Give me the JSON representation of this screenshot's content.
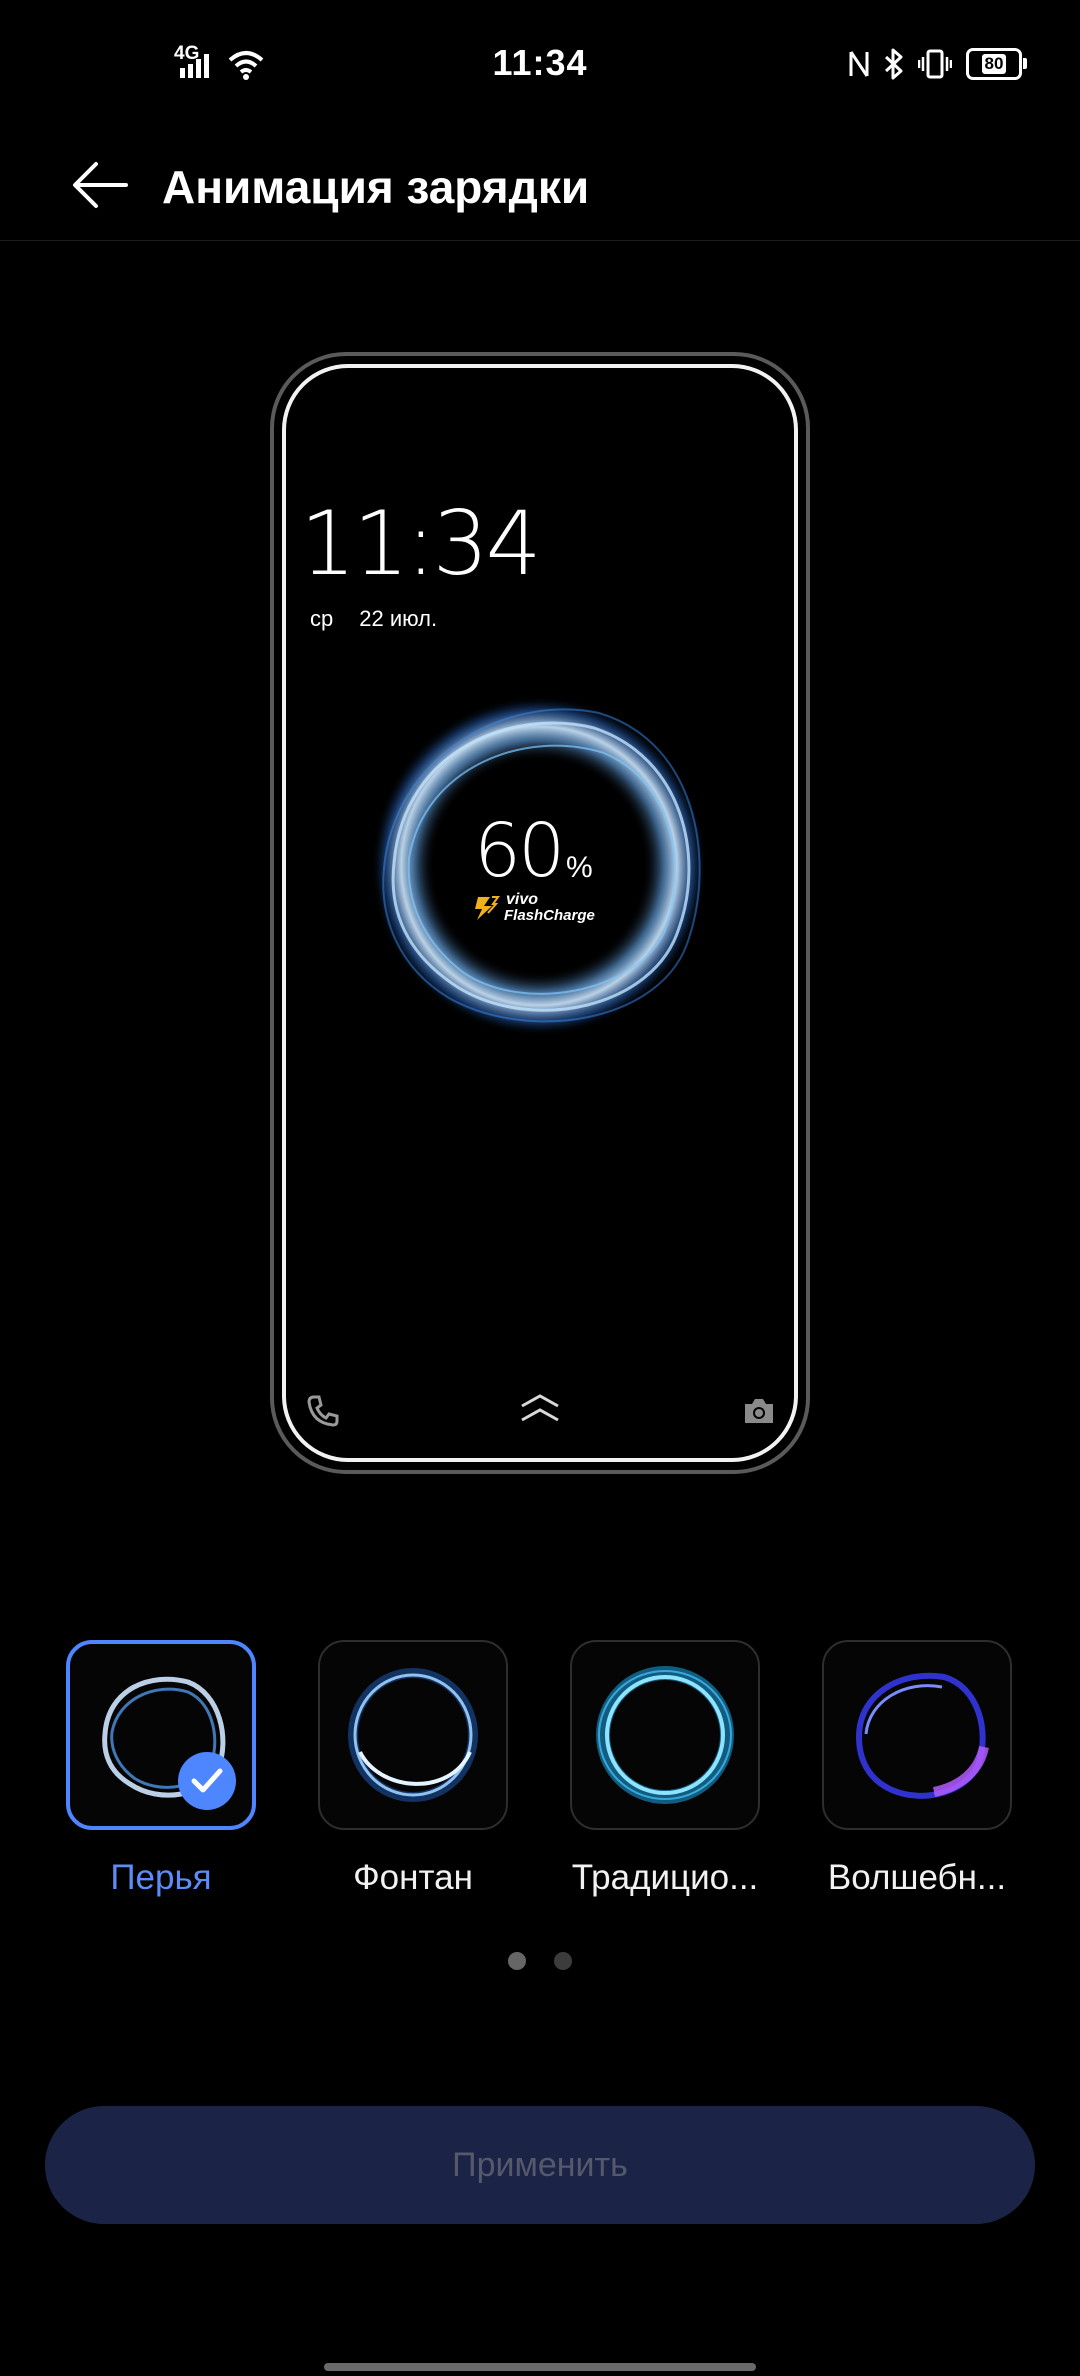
{
  "status_bar": {
    "time": "11:34",
    "network": "4G",
    "battery": "80",
    "icons": [
      "signal-icon",
      "wifi-icon",
      "nfc-icon",
      "bluetooth-icon",
      "vibrate-icon",
      "battery-icon"
    ]
  },
  "header": {
    "title": "Анимация зарядки",
    "back_icon": "arrow-left-icon"
  },
  "preview": {
    "time": "11:34",
    "day": "ср",
    "date": "22 июл.",
    "percent": "60",
    "percent_sign": "%",
    "brand": "vivo",
    "brand_sub": "FlashCharge",
    "bottom_icons": [
      "phone-icon",
      "chevron-up-icon",
      "camera-icon"
    ]
  },
  "options": [
    {
      "label": "Перья",
      "selected": true
    },
    {
      "label": "Фонтан",
      "selected": false
    },
    {
      "label": "Традицио...",
      "selected": false
    },
    {
      "label": "Волшебн...",
      "selected": false
    }
  ],
  "pagination": {
    "pages": 2,
    "current": 1
  },
  "apply_button": {
    "label": "Применить",
    "enabled": false
  },
  "colors": {
    "accent": "#4d86ff",
    "apply_bg": "#1b2447",
    "ring_blue": "#7fc8ff",
    "ring_purple": "#8b3dff"
  }
}
